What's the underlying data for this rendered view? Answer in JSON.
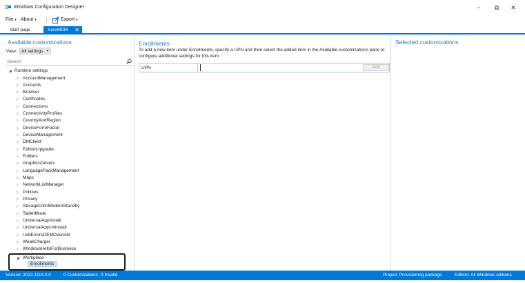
{
  "window": {
    "title": "Windows Configuration Designer",
    "min_glyph": "−",
    "max_glyph": "⧉",
    "close_glyph": "✕"
  },
  "menu": {
    "file_label": "File",
    "about_label": "About",
    "export_label": "Export"
  },
  "tabs": [
    {
      "label": "Start page"
    },
    {
      "label": "SureMDM",
      "close_glyph": "✕"
    }
  ],
  "left_panel": {
    "heading": "Available customizations",
    "view_label": "View:",
    "view_selected": "All settings",
    "search_placeholder": "Search",
    "tree_root": "Runtime settings",
    "tree_items": [
      "AccountManagement",
      "Accounts",
      "Browser",
      "Certificates",
      "Connections",
      "ConnectivityProfiles",
      "CountryAndRegion",
      "DeviceFormFactor",
      "DeviceManagement",
      "DMClient",
      "EditionUpgrade",
      "Folders",
      "GraphicsDrivers",
      "LanguagePackManagement",
      "Maps",
      "NetworkListManager",
      "Policies",
      "Privacy",
      "StorageD3InModernStandby",
      "TabletMode",
      "UniversalAppInstall",
      "UniversalAppUninstall",
      "UsbErrorsOEMOverride",
      "WeakCharger",
      "WindowsHelloForBusiness"
    ],
    "workplace_label": "Workplace",
    "enrollments_label": "Enrollments"
  },
  "middle_panel": {
    "heading": "Enrollments",
    "description": "To add a new item under Enrollments, specify a UPN and then select the added item in the Available customizations pane to configure additional settings for this item.",
    "upn_label": "UPN",
    "upn_value": "",
    "add_label": "Add"
  },
  "right_panel": {
    "heading": "Selected customizations"
  },
  "status": {
    "version": "Version: 2022.1118.0.0",
    "customizations": "0 Customizations",
    "invalid": "0 Invalid",
    "project": "Project: Provisioning package",
    "edition": "Edition: All Windows editions"
  },
  "colors": {
    "accent": "#0078d7",
    "heading": "#2b79c2",
    "selection": "#cce4f7"
  }
}
